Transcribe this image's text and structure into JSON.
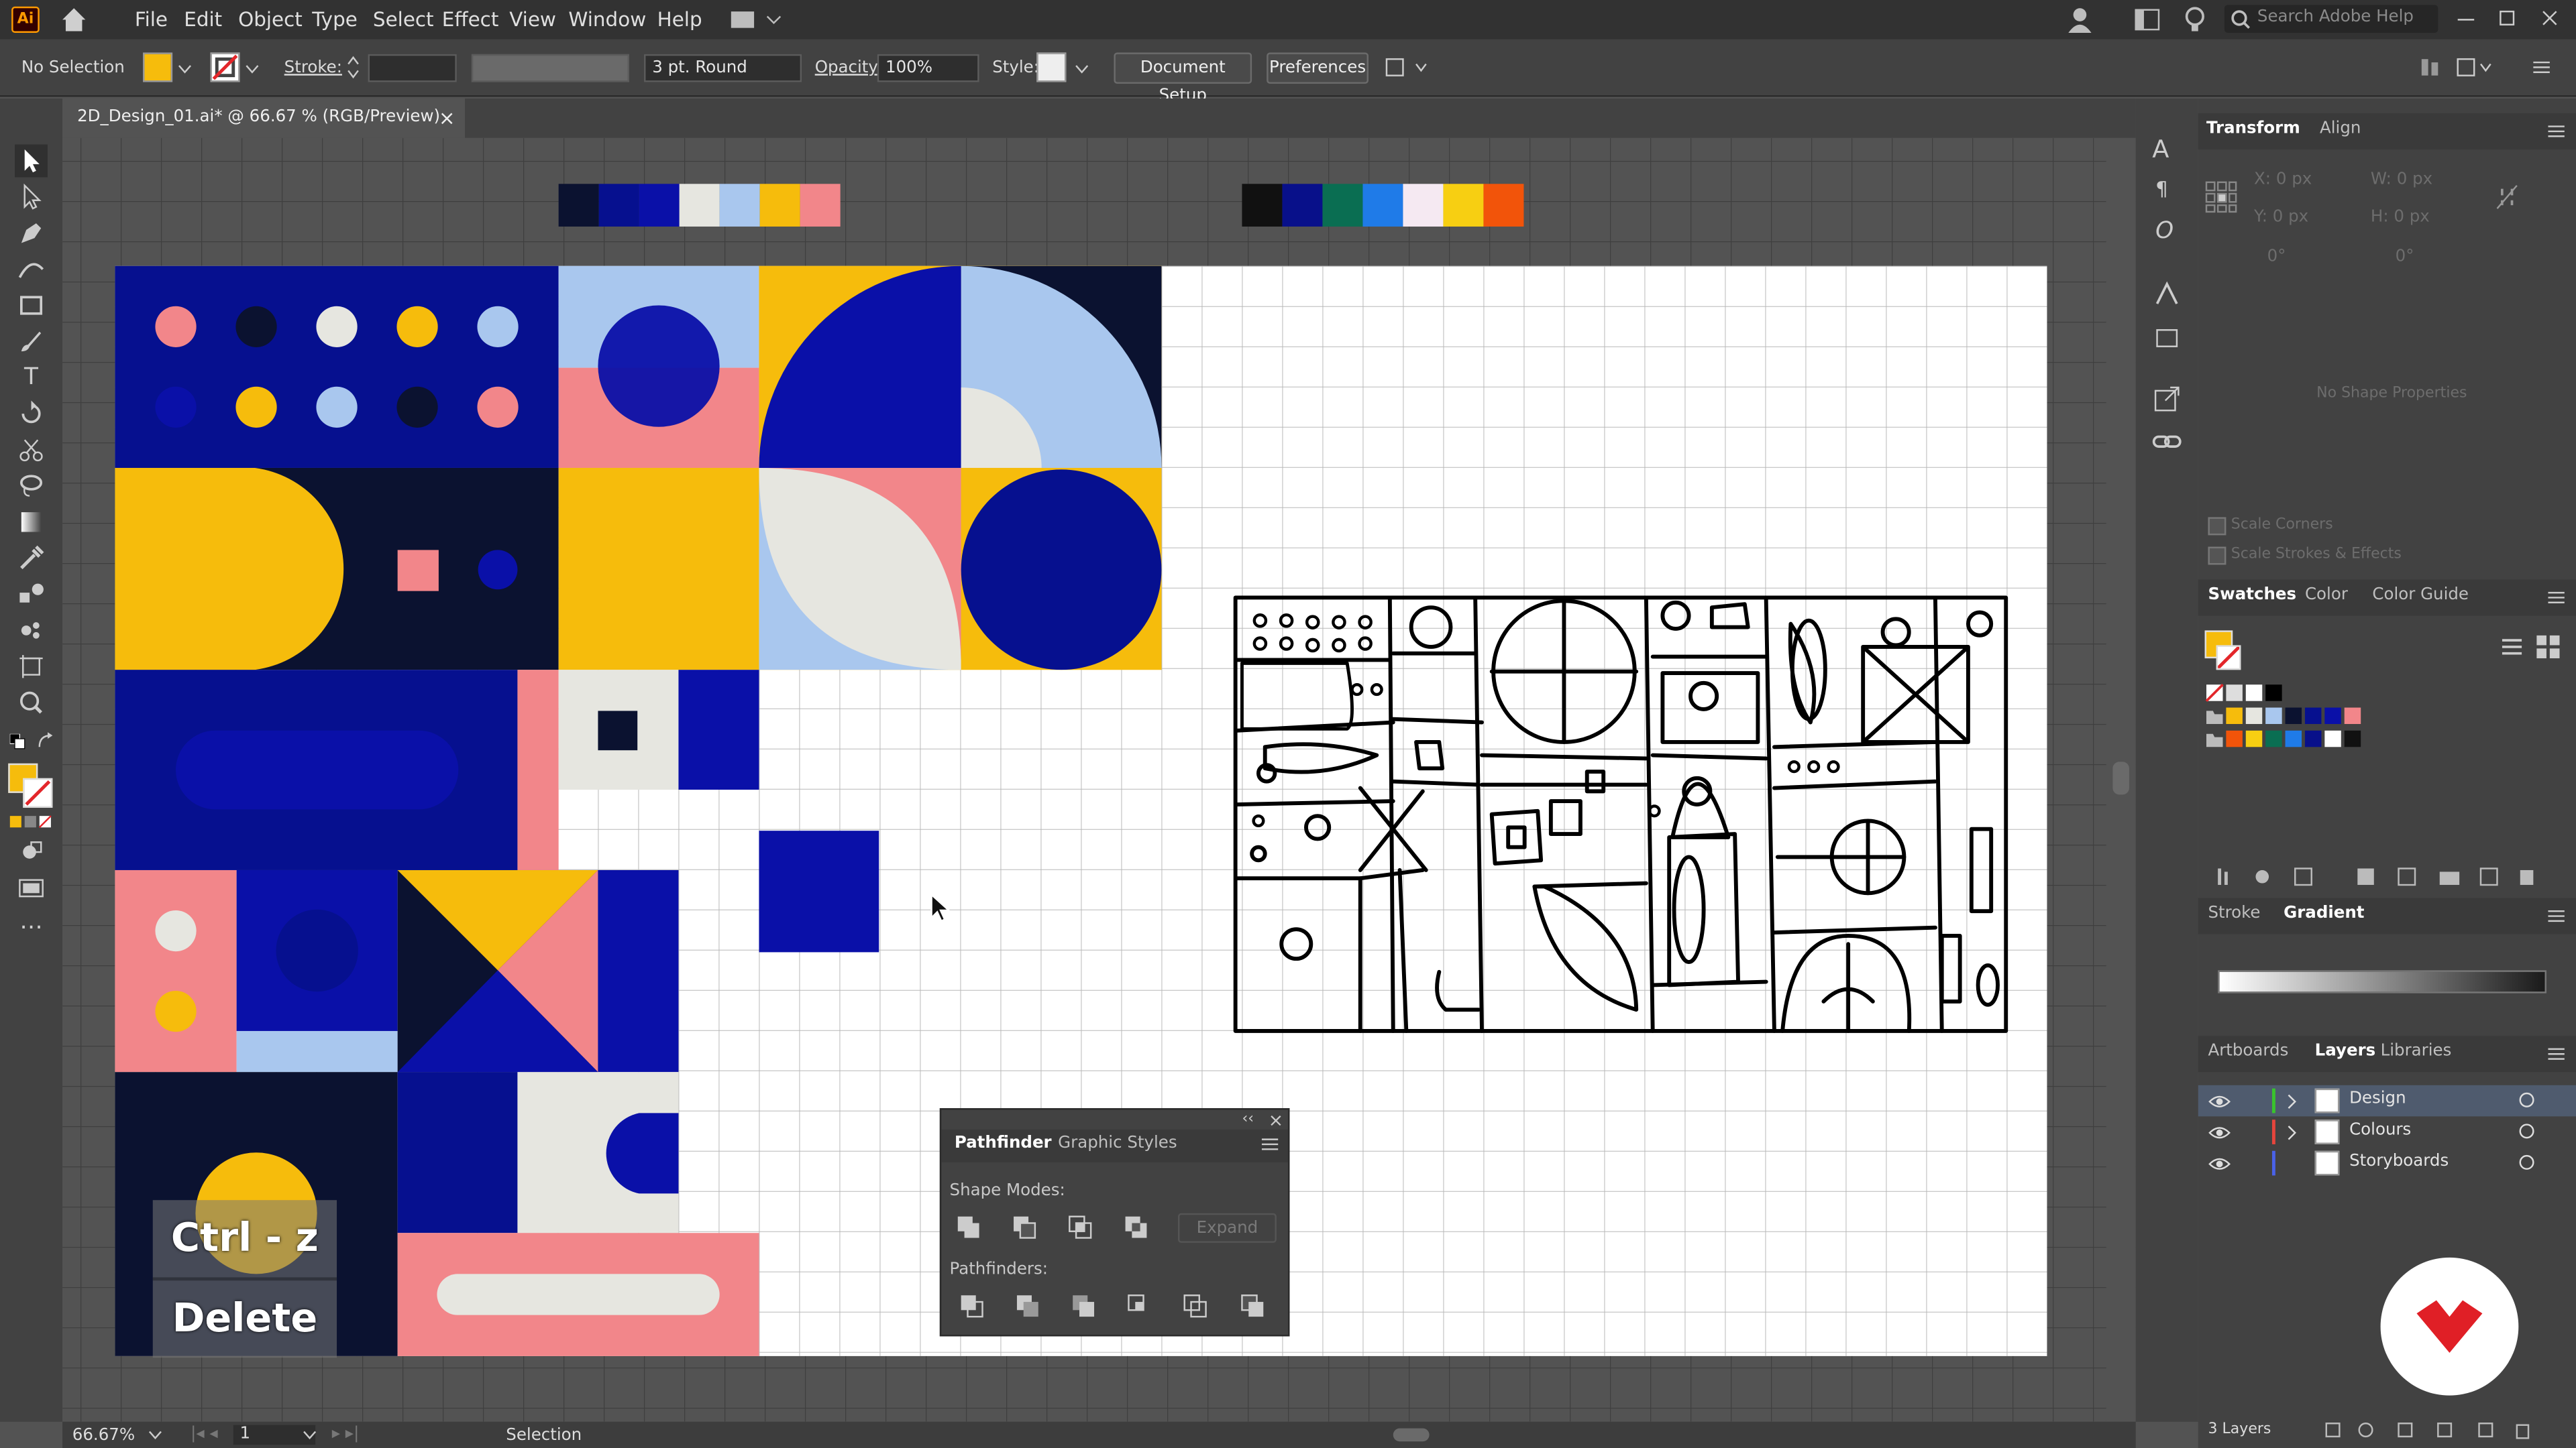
{
  "app": {
    "logo": "Ai"
  },
  "menu": [
    "File",
    "Edit",
    "Object",
    "Type",
    "Select",
    "Effect",
    "View",
    "Window",
    "Help"
  ],
  "search": {
    "placeholder": "Search Adobe Help"
  },
  "control": {
    "selection": "No Selection",
    "stroke_label": "Stroke:",
    "brush": "3 pt. Round",
    "opacity_label": "Opacity:",
    "opacity": "100%",
    "style_label": "Style:",
    "doc_setup": "Document Setup",
    "preferences": "Preferences",
    "fill_color": "#f6bc0c"
  },
  "document": {
    "tab": "2D_Design_01.ai* @ 66.67 % (RGB/Preview)",
    "close": "×"
  },
  "overlay": {
    "line1": "Ctrl - z",
    "line2": "Delete"
  },
  "palette1": [
    "#0b1230",
    "#06108f",
    "#0a10a8",
    "#e6e6e0",
    "#a9c7ee",
    "#f6bc0c",
    "#f2868a"
  ],
  "palette2": [
    "#111111",
    "#08108a",
    "#0a6e52",
    "#1f7be8",
    "#f5e9f2",
    "#f7cf12",
    "#f2540a"
  ],
  "pathfinder": {
    "tab1": "Pathfinder",
    "tab2": "Graphic Styles",
    "shape_modes": "Shape Modes:",
    "expand": "Expand",
    "pathfinders": "Pathfinders:"
  },
  "transform": {
    "tab1": "Transform",
    "tab2": "Align",
    "x": "X: 0 px",
    "y": "Y: 0 px",
    "w": "W: 0 px",
    "h": "H: 0 px",
    "angle": "0°",
    "shear": "0°",
    "empty": "No Shape Properties",
    "scale_corners": "Scale Corners",
    "scale_strokes": "Scale Strokes & Effects"
  },
  "swatches": {
    "tab1": "Swatches",
    "tab2": "Color",
    "tab3": "Color Guide"
  },
  "gradient": {
    "tab1": "Stroke",
    "tab2": "Gradient"
  },
  "layers_panel": {
    "tab1": "Artboards",
    "tab2": "Layers",
    "tab3": "Libraries",
    "count": "3 Layers"
  },
  "layers": [
    {
      "name": "Design",
      "color": "#39c42c"
    },
    {
      "name": "Colours",
      "color": "#e6453c"
    },
    {
      "name": "Storyboards",
      "color": "#4a62e8"
    }
  ],
  "status": {
    "zoom": "66.67%",
    "artboard": "1",
    "mode": "Selection"
  }
}
